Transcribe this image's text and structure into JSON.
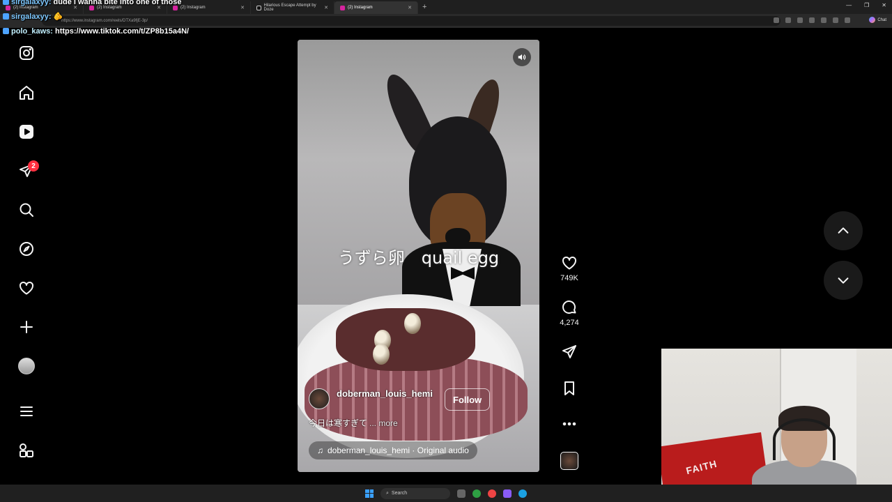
{
  "browser": {
    "tabs": [
      {
        "label": "(2) Instagram",
        "active": false
      },
      {
        "label": "(2) Instagram",
        "active": false
      },
      {
        "label": "(2) Instagram",
        "active": false
      },
      {
        "label": "Hilarious Escape Attempt by Doze",
        "active": false
      },
      {
        "label": "(2) Instagram",
        "active": true
      }
    ],
    "url": "https://www.instagram.com/reels/DTXa9fjE-3p/",
    "copilot_label": "Chat"
  },
  "stream_chat": [
    {
      "user": "sirgalaxyy:",
      "message": "dude I wanna bite into one of those"
    },
    {
      "user": "sirgalaxyy:",
      "message": ""
    },
    {
      "user": "polo_kaws:",
      "message": "https://www.tiktok.com/t/ZP8b15a4N/"
    }
  ],
  "sidebar": {
    "icons": [
      "instagram-logo-icon",
      "home-icon",
      "reels-icon",
      "messages-icon",
      "search-icon",
      "explore-icon",
      "notifications-heart-icon",
      "create-plus-icon",
      "profile-avatar",
      "menu-icon",
      "also-from-meta-icon"
    ],
    "messages_badge": "2"
  },
  "reel": {
    "subtitle": "うずら卵　quail egg",
    "author": "doberman_louis_hemi",
    "follow_label": "Follow",
    "caption": "今日は寒すぎて",
    "more_label": "... more",
    "audio": "doberman_louis_hemi · Original audio"
  },
  "actions": {
    "likes": "749K",
    "comments": "4,274"
  },
  "taskbar": {
    "search_label": "Search"
  },
  "webcam": {
    "flag_text": "FAITH"
  },
  "colors": {
    "background": "#000000",
    "badge": "#ff3040",
    "taskbar": "#202020"
  }
}
